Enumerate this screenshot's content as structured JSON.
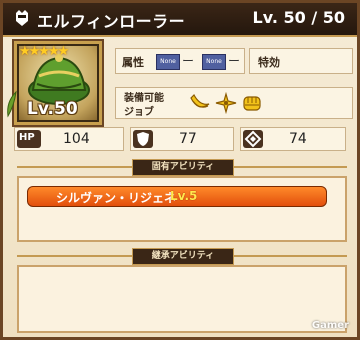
{
  "header": {
    "name": "エルフィンローラー",
    "level_label": "Lv.",
    "level_value": "50 / 50"
  },
  "portrait": {
    "stars": "★★★★★",
    "level_text": "Lv.50"
  },
  "info": {
    "attribute_label": "属性",
    "attribute_slots": [
      {
        "badge": "None",
        "value": "ー"
      },
      {
        "badge": "None",
        "value": "ー"
      }
    ],
    "special_label": "特効",
    "equip_label_line1": "装備可能",
    "equip_label_line2": "ジョブ",
    "equip_jobs": [
      "banana-icon",
      "shuriken-icon",
      "fist-icon"
    ]
  },
  "stats": {
    "hp_label": "HP",
    "hp": "104",
    "defense_icon": "shield-icon",
    "defense": "77",
    "magic_defense_icon": "diamond-icon",
    "magic_defense": "74"
  },
  "unique_ability": {
    "heading": "固有アビリティ",
    "skill_name": "シルヴァン・リジェネ",
    "skill_level": "Lv.5"
  },
  "inherited_ability": {
    "heading": "継承アビリティ"
  },
  "watermark": "Gamer",
  "colors": {
    "skill_pill": "#f06a1c",
    "skill_level": "#ffe94d",
    "attribute_badge": "#5060a0",
    "frame_gold": "#c49a52"
  }
}
